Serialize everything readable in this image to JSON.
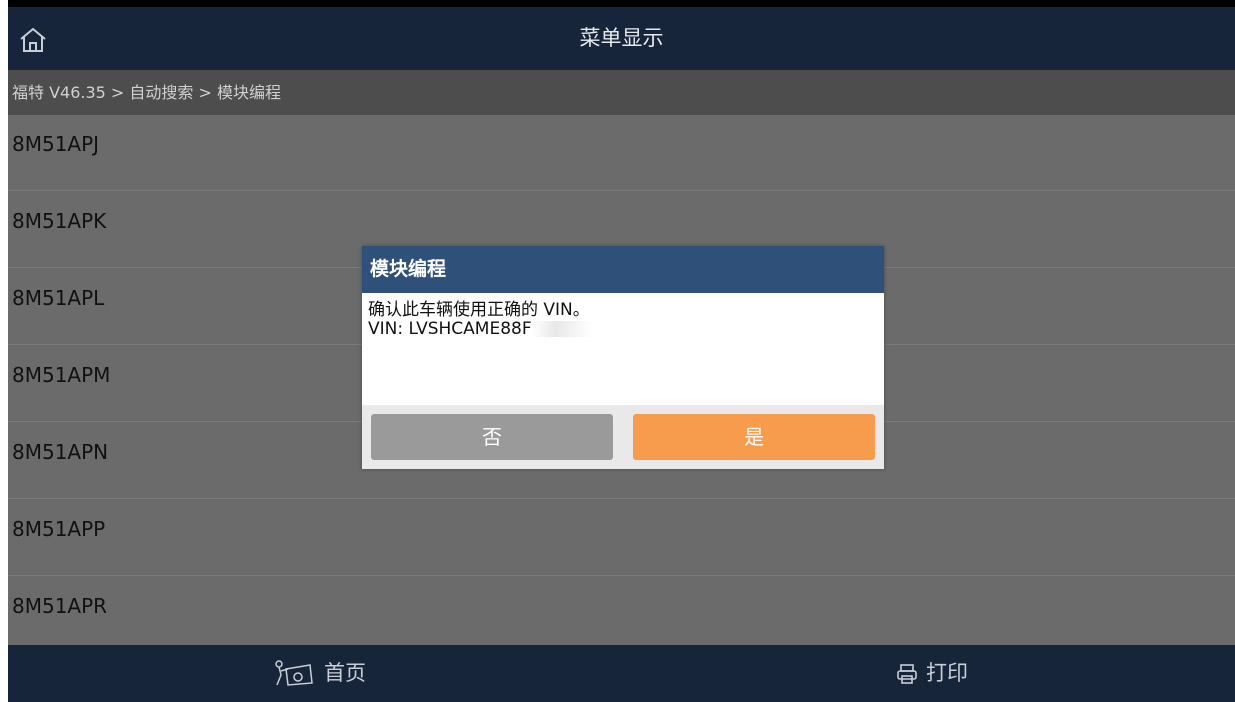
{
  "header": {
    "title": "菜单显示",
    "home_icon": "home-icon"
  },
  "breadcrumb": "福特 V46.35 > 自动搜索 > 模块编程",
  "menu_items": [
    "8M51APJ",
    "8M51APK",
    "8M51APL",
    "8M51APM",
    "8M51APN",
    "8M51APP",
    "8M51APR"
  ],
  "dialog": {
    "title": "模块编程",
    "message_line1": "确认此车辆使用正确的 VIN。",
    "vin_label": "VIN: LVSHCAME88F",
    "no_label": "否",
    "yes_label": "是"
  },
  "bottom_bar": {
    "home_label": "首页",
    "print_label": "打印"
  },
  "colors": {
    "title_bar": "#17253a",
    "breadcrumb_bg": "#4d4d4d",
    "list_overlay": "#6b6b6b",
    "dialog_header": "#2e5079",
    "button_no": "#9a9a9a",
    "button_yes": "#f79c4c"
  }
}
